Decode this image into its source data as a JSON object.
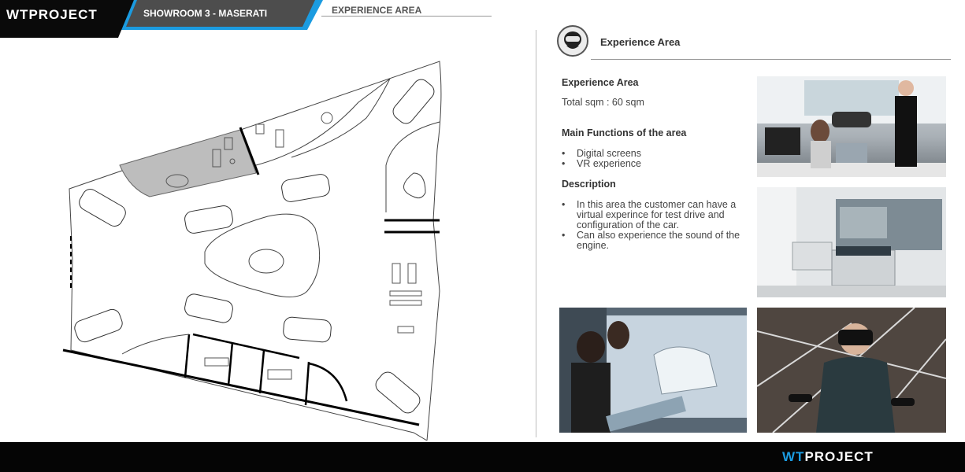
{
  "header": {
    "logo_a": "WT",
    "logo_b": "PROJECT",
    "showroom": "SHOWROOM 3  -  MASERATI",
    "area_title": "EXPERIENCE AREA"
  },
  "section": {
    "icon": "vr-headset-icon",
    "title": "Experience Area"
  },
  "info": {
    "heading": "Experience Area",
    "total_sqm": "Total sqm  : 60 sqm",
    "functions_heading": "Main Functions of the area",
    "functions": [
      "Digital screens",
      "VR experience"
    ],
    "description_heading": "Description",
    "description": [
      "In this area the customer can have a virtual experince for test drive and configuration of the car.",
      "Can also experience the sound of the engine."
    ]
  },
  "footer": {
    "logo_a": "WT",
    "logo_b": "PROJECT"
  },
  "colors": {
    "accent_blue": "#1b9be0",
    "header_grey": "#4d4d4d",
    "black": "#050505"
  }
}
